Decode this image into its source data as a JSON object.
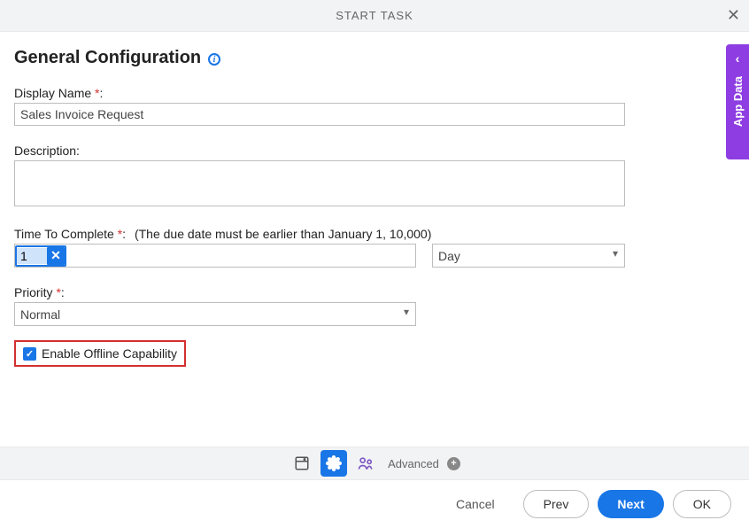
{
  "header": {
    "title": "START TASK"
  },
  "section": {
    "title": "General Configuration"
  },
  "displayName": {
    "label": "Display Name",
    "value": "Sales Invoice Request"
  },
  "description": {
    "label": "Description:",
    "value": ""
  },
  "ttc": {
    "label": "Time To Complete",
    "hint": "(The due date must be earlier than January 1, 10,000)",
    "value": "1",
    "unit": "Day"
  },
  "priority": {
    "label": "Priority",
    "value": "Normal"
  },
  "offline": {
    "label": "Enable Offline Capability",
    "checked": true
  },
  "toolbar": {
    "advanced": "Advanced"
  },
  "footer": {
    "cancel": "Cancel",
    "prev": "Prev",
    "next": "Next",
    "ok": "OK"
  },
  "sideTab": {
    "label": "App Data"
  }
}
